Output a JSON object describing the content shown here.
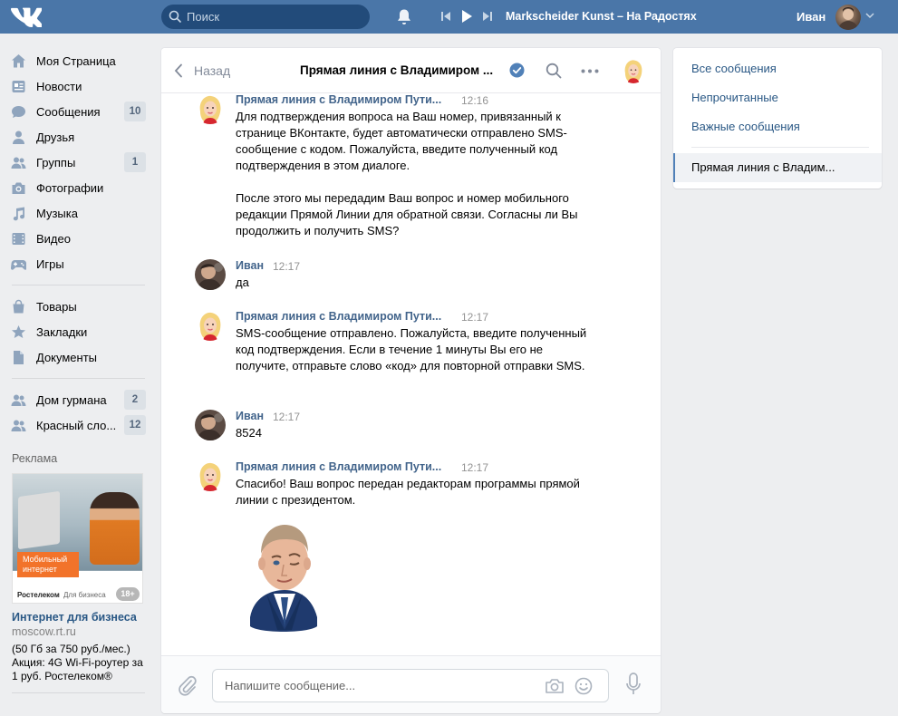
{
  "header": {
    "search_placeholder": "Поиск",
    "track": "Markscheider Kunst – На Радостях",
    "username": "Иван"
  },
  "menu": [
    {
      "label": "Моя Страница",
      "icon": "home-icon",
      "count": ""
    },
    {
      "label": "Новости",
      "icon": "news-icon",
      "count": ""
    },
    {
      "label": "Сообщения",
      "icon": "messages-icon",
      "count": "10"
    },
    {
      "label": "Друзья",
      "icon": "friends-icon",
      "count": ""
    },
    {
      "label": "Группы",
      "icon": "groups-icon",
      "count": "1"
    },
    {
      "label": "Фотографии",
      "icon": "camera-icon",
      "count": ""
    },
    {
      "label": "Музыка",
      "icon": "music-icon",
      "count": ""
    },
    {
      "label": "Видео",
      "icon": "video-icon",
      "count": ""
    },
    {
      "label": "Игры",
      "icon": "gamepad-icon",
      "count": ""
    },
    {
      "label": "Товары",
      "icon": "bag-icon",
      "count": ""
    },
    {
      "label": "Закладки",
      "icon": "star-icon",
      "count": ""
    },
    {
      "label": "Документы",
      "icon": "document-icon",
      "count": ""
    },
    {
      "label": "Дом гурмана",
      "icon": "group-icon",
      "count": "2"
    },
    {
      "label": "Красный сло...",
      "icon": "group-icon",
      "count": "12"
    }
  ],
  "ad": {
    "section_title": "Реклама",
    "badge": "Мобильный интернет",
    "brand": "Ростелеком",
    "brand_sub": "Для бизнеса",
    "age": "18+",
    "headline": "Интернет для бизнеса",
    "url": "moscow.rt.ru",
    "description": "(50 Гб за 750 руб./мес.) Акция: 4G Wi-Fi-роутер за 1 руб. Ростелеком®"
  },
  "chat": {
    "back_label": "Назад",
    "title": "Прямая линия с Владимиром ...",
    "composer_placeholder": "Напишите сообщение...",
    "messages": [
      {
        "sender": "Прямая линия с Владимиром Пути...",
        "time": "12:16",
        "text": "Для подтверждения вопроса на Ваш номер, привязанный к странице ВКонтакте, будет автоматически отправлено SMS-сообщение с кодом. Пожалуйста, введите полученный код подтверждения в этом диалоге.\n\nПосле этого мы передадим Ваш вопрос и номер мобильного редакции Прямой Линии для обратной связи. Согласны ли Вы продолжить и получить SMS?"
      },
      {
        "sender": "Иван",
        "time": "12:17",
        "text": "да"
      },
      {
        "sender": "Прямая линия с Владимиром Пути...",
        "time": "12:17",
        "text": "SMS-сообщение отправлено. Пожалуйста, введите полученный код подтверждения. Если в течение 1 минуты Вы его не получите, отправьте слово «код» для повторной отправки SMS."
      },
      {
        "sender": "Иван",
        "time": "12:17",
        "text": "8524"
      },
      {
        "sender": "Прямая линия с Владимиром Пути...",
        "time": "12:17",
        "text": "Спасибо! Ваш вопрос передан редакторам программы прямой линии с президентом."
      }
    ]
  },
  "right_panel": {
    "items": [
      "Все сообщения",
      "Непрочитанные",
      "Важные сообщения"
    ],
    "active": "Прямая линия с Владим..."
  },
  "colors": {
    "brand": "#4a76a8",
    "link": "#2a5885",
    "name": "#42648b",
    "accent": "#5181b8"
  }
}
